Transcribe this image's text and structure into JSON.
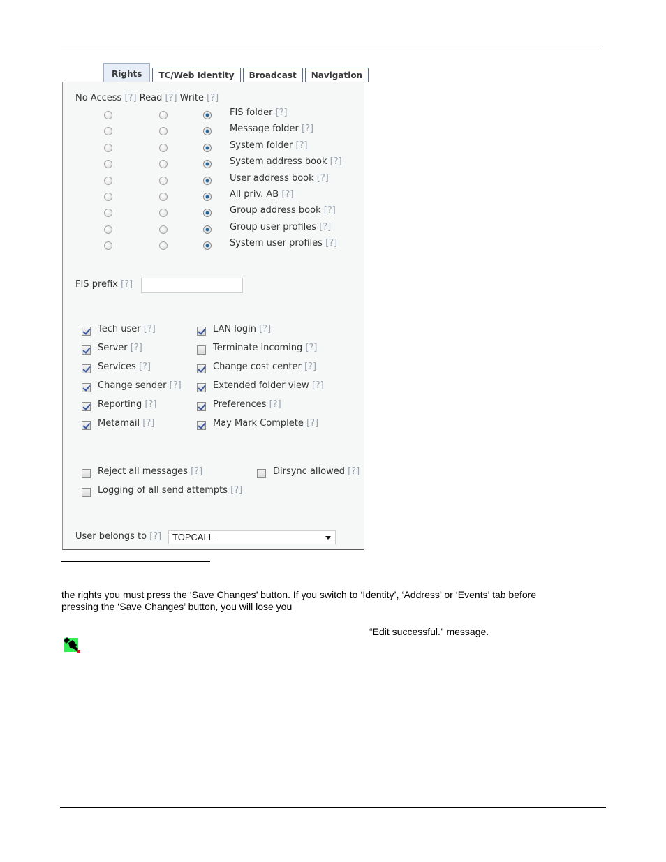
{
  "tabs": [
    {
      "label": "Rights",
      "active": true
    },
    {
      "label": "TC/Web Identity",
      "active": false
    },
    {
      "label": "Broadcast",
      "active": false
    },
    {
      "label": "Navigation",
      "active": false
    }
  ],
  "access_header": {
    "no_access": "No Access",
    "read": "Read",
    "write": "Write",
    "hint": "[?]"
  },
  "access_rows": [
    {
      "label": "FIS folder",
      "selected": "write"
    },
    {
      "label": "Message folder",
      "selected": "write"
    },
    {
      "label": "System folder",
      "selected": "write"
    },
    {
      "label": "System address book",
      "selected": "write"
    },
    {
      "label": "User address book",
      "selected": "write"
    },
    {
      "label": "All priv. AB",
      "selected": "write"
    },
    {
      "label": "Group address book",
      "selected": "write"
    },
    {
      "label": "Group user profiles",
      "selected": "write"
    },
    {
      "label": "System user profiles",
      "selected": "write"
    }
  ],
  "fis_prefix": {
    "label": "FIS prefix",
    "value": ""
  },
  "flags_left": [
    {
      "label": "Tech user",
      "checked": true
    },
    {
      "label": "Server",
      "checked": true
    },
    {
      "label": "Services",
      "checked": true
    },
    {
      "label": "Change sender",
      "checked": true
    },
    {
      "label": "Reporting",
      "checked": true
    },
    {
      "label": "Metamail",
      "checked": true
    }
  ],
  "flags_right": [
    {
      "label": "LAN login",
      "checked": true
    },
    {
      "label": "Terminate incoming",
      "checked": false
    },
    {
      "label": "Change cost center",
      "checked": true
    },
    {
      "label": "Extended folder view",
      "checked": true
    },
    {
      "label": "Preferences",
      "checked": true
    },
    {
      "label": "May Mark Complete",
      "checked": true
    }
  ],
  "extra_flags": [
    {
      "label": "Reject all messages",
      "checked": false
    },
    {
      "label": "Dirsync allowed",
      "checked": false
    },
    {
      "label": "Logging of all send attempts",
      "checked": false
    }
  ],
  "user_belongs_to": {
    "label": "User belongs to",
    "value": "TOPCALL"
  },
  "hint": "[?]",
  "body_text": {
    "line1": "the rights you must press the ‘Save Changes’ button. If you switch to ‘Identity’, ‘Address’ or ‘Events’ tab before",
    "line2": "pressing the ‘Save Changes’ button, you will lose you",
    "line3": "“Edit successful.” message."
  },
  "icons": {
    "note": "note-pen-icon"
  }
}
